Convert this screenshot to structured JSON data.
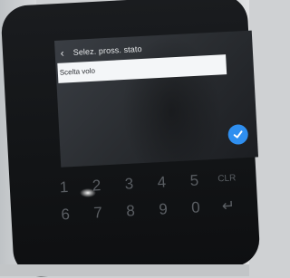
{
  "header": {
    "back_icon": "chevron-left-icon",
    "title": "Selez. pross. stato"
  },
  "input": {
    "value": "Scelta volo"
  },
  "confirm": {
    "icon": "check-icon",
    "color": "#2f8ff0"
  },
  "keypad": {
    "row1": [
      "1",
      "2",
      "3",
      "4",
      "5",
      "CLR"
    ],
    "row2": [
      "6",
      "7",
      "8",
      "9",
      "0",
      "↵"
    ]
  }
}
